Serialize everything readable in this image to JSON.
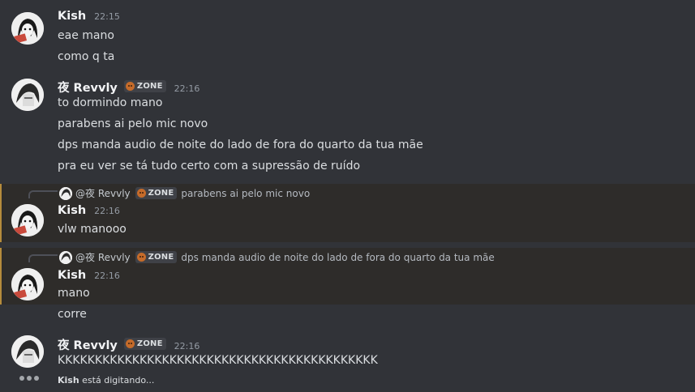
{
  "messages": [
    {
      "author": "Kish",
      "time": "22:15",
      "lines": [
        "eae mano",
        "como q ta"
      ]
    },
    {
      "author": "夜 Revvly",
      "tag": "ZONE",
      "time": "22:16",
      "lines": [
        "to dormindo mano",
        "parabens ai pelo mic novo",
        "dps manda audio de noite do lado de fora do quarto da tua mãe",
        "pra eu ver se tá tudo certo com a supressão de ruído"
      ]
    },
    {
      "reply_to": "@夜 Revvly",
      "reply_tag": "ZONE",
      "reply_text": "parabens ai pelo mic novo",
      "author": "Kish",
      "time": "22:16",
      "lines": [
        "vlw manooo"
      ]
    },
    {
      "reply_to": "@夜 Revvly",
      "reply_tag": "ZONE",
      "reply_text": "dps manda audio de noite do lado de fora do quarto da tua mãe",
      "author": "Kish",
      "time": "22:16",
      "lines": [
        "mano",
        "corre"
      ]
    },
    {
      "author": "夜 Revvly",
      "tag": "ZONE",
      "time": "22:16",
      "lines": [
        "KKKKKKKKKKKKKKKKKKKKKKKKKKKKKKKKKKKKKKKKKKK"
      ]
    }
  ],
  "typing": {
    "user": "Kish",
    "suffix": " está digitando..."
  },
  "colors": {
    "background": "#313338",
    "highlight_bar": "#b58b3c",
    "highlight_bg": "#2e2c2a"
  }
}
